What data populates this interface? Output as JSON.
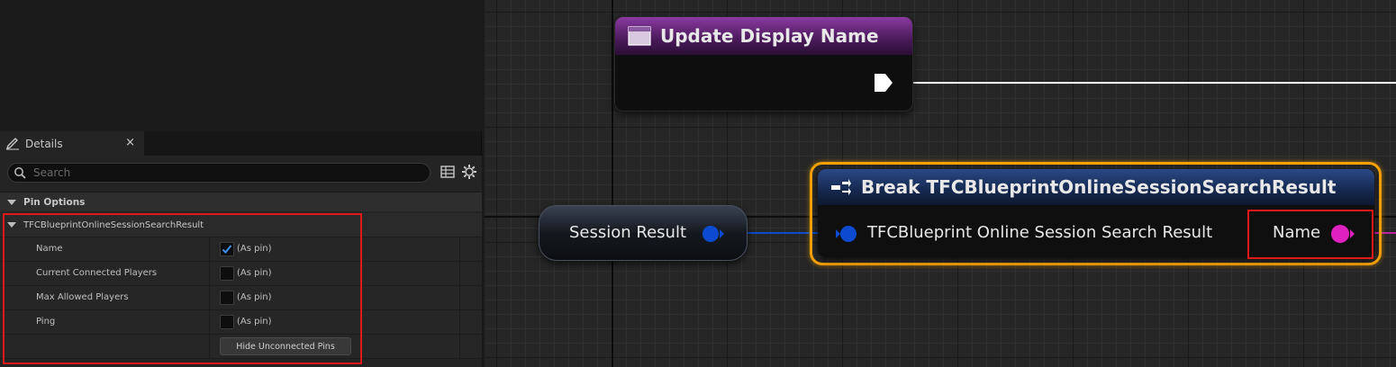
{
  "details_panel": {
    "tab_label": "Details",
    "close_glyph": "×",
    "search_placeholder": "Search",
    "category_label": "Pin Options",
    "struct_label": "TFCBlueprintOnlineSessionSearchResult",
    "properties": [
      {
        "name": "Name",
        "checked": true,
        "value_label": "(As pin)"
      },
      {
        "name": "Current Connected Players",
        "checked": false,
        "value_label": "(As pin)"
      },
      {
        "name": "Max Allowed Players",
        "checked": false,
        "value_label": "(As pin)"
      },
      {
        "name": "Ping",
        "checked": false,
        "value_label": "(As pin)"
      }
    ],
    "hide_unconnected_label": "Hide Unconnected Pins",
    "icons": [
      "pencil-icon",
      "search-icon",
      "grid-icon",
      "gear-icon",
      "collapse-triangle-icon",
      "checkmark-icon"
    ]
  },
  "graph": {
    "update_node": {
      "title": "Update Display Name",
      "icon": "function-icon",
      "color": "#8a3aa0"
    },
    "session_node": {
      "label": "Session Result"
    },
    "break_node": {
      "title": "Break TFCBlueprintOnlineSessionSearchResult",
      "icon": "break-struct-icon",
      "input_label": "TFCBlueprint Online Session Search Result",
      "output_label": "Name",
      "header_color": "#2a4a86",
      "outline_color": "#f4a000"
    },
    "colors": {
      "struct_pin": "#0c4bd0",
      "name_pin": "#e020c0",
      "exec_wire": "#ffffff",
      "highlight_box": "#e01818"
    }
  }
}
